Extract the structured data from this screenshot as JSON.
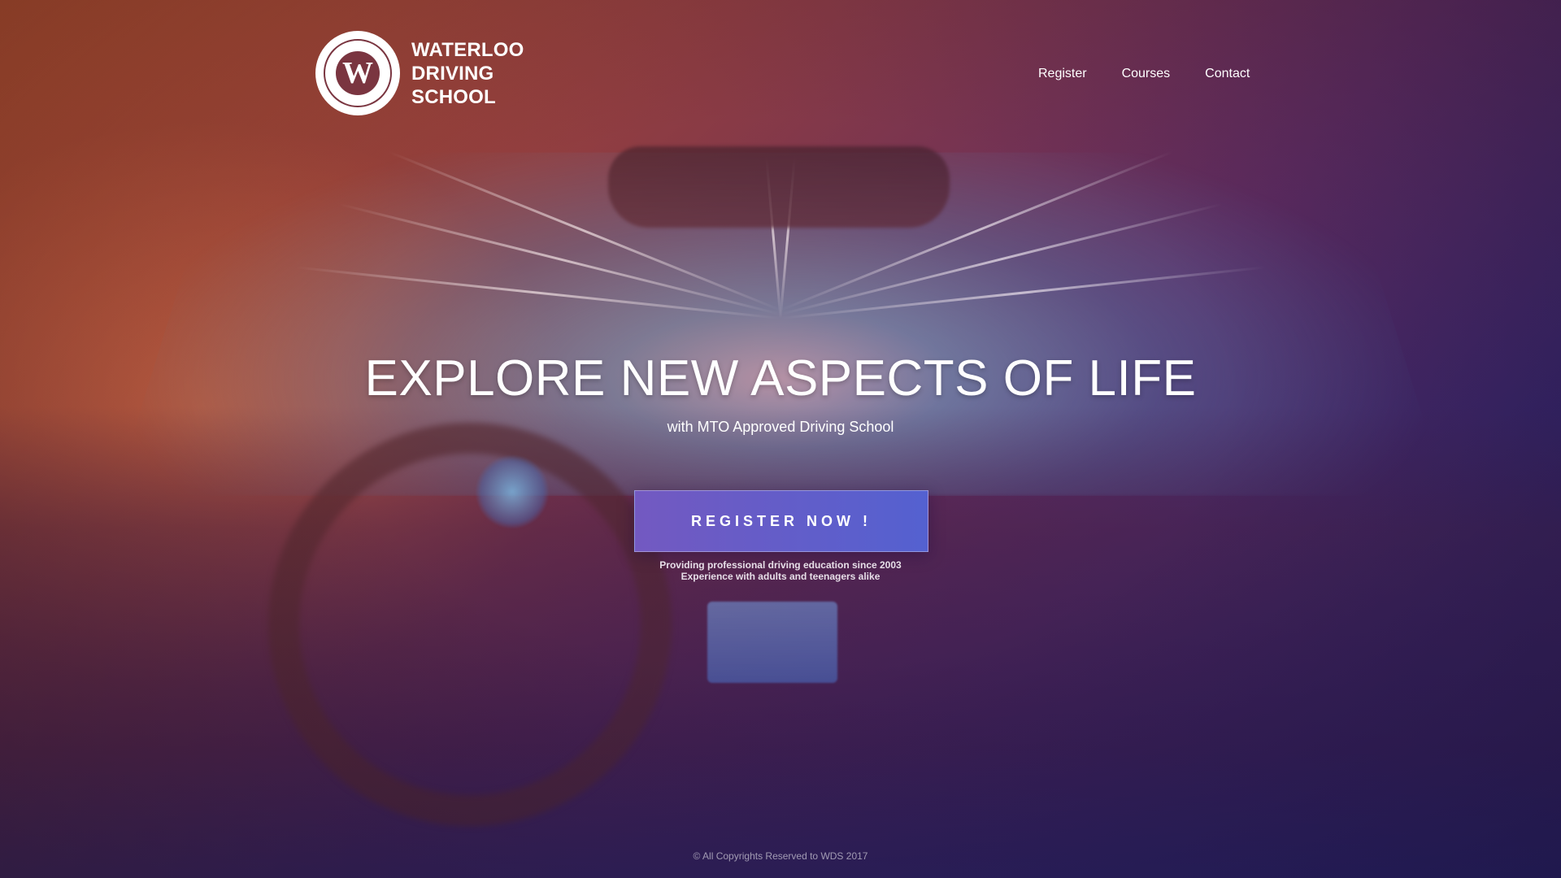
{
  "brand": {
    "logo_letter": "W",
    "logo_ring_text": "WATERLOO DRIVING SCHOOL",
    "name_line1": "WATERLOO",
    "name_line2": "DRIVING",
    "name_line3": "SCHOOL"
  },
  "nav": {
    "items": [
      {
        "label": "Register"
      },
      {
        "label": "Courses"
      },
      {
        "label": "Contact"
      }
    ]
  },
  "hero": {
    "headline": "EXPLORE NEW ASPECTS OF LIFE",
    "subheadline": "with MTO Approved Driving School",
    "cta_label": "REGISTER NOW !",
    "tagline_line1": "Providing professional driving education since 2003",
    "tagline_line2": "Experience with adults and teenagers alike"
  },
  "footer": {
    "copyright": "© All Copyrights Reserved to WDS 2017"
  },
  "colors": {
    "cta_start": "#7359c1",
    "cta_end": "#5461d0",
    "logo_accent": "#7a3540"
  }
}
